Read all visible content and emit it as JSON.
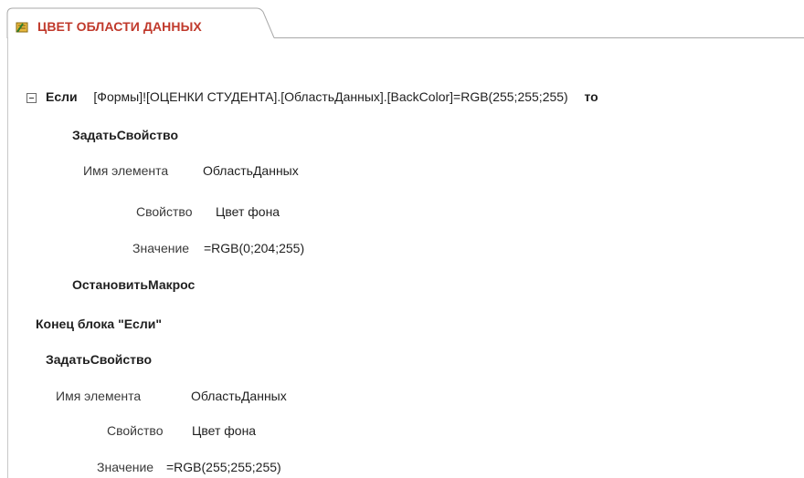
{
  "tab": {
    "title": "ЦВЕТ ОБЛАСТИ ДАННЫХ",
    "icon": "macro-scroll-icon"
  },
  "if_block": {
    "keyword": "Если",
    "condition": "[Формы]![ОЦЕНКИ СТУДЕНТА].[ОбластьДанных].[BackColor]=RGB(255;255;255)",
    "then_keyword": "то",
    "collapse_icon": "collapse-minus-icon",
    "action1": {
      "name": "ЗадатьСвойство",
      "element_label": "Имя элемента",
      "element_value": "ОбластьДанных",
      "property_label": "Свойство",
      "property_value": "Цвет фона",
      "value_label": "Значение",
      "value_value": "=RGB(0;204;255)"
    },
    "action2": {
      "name": "ОстановитьМакрос"
    },
    "end_label": "Конец блока \"Если\""
  },
  "action3": {
    "name": "ЗадатьСвойство",
    "element_label": "Имя элемента",
    "element_value": "ОбластьДанных",
    "property_label": "Свойство",
    "property_value": "Цвет фона",
    "value_label": "Значение",
    "value_value": "=RGB(255;255;255)"
  },
  "colors": {
    "tab_text": "#c0392b",
    "tab_border": "#a9a9a9"
  }
}
